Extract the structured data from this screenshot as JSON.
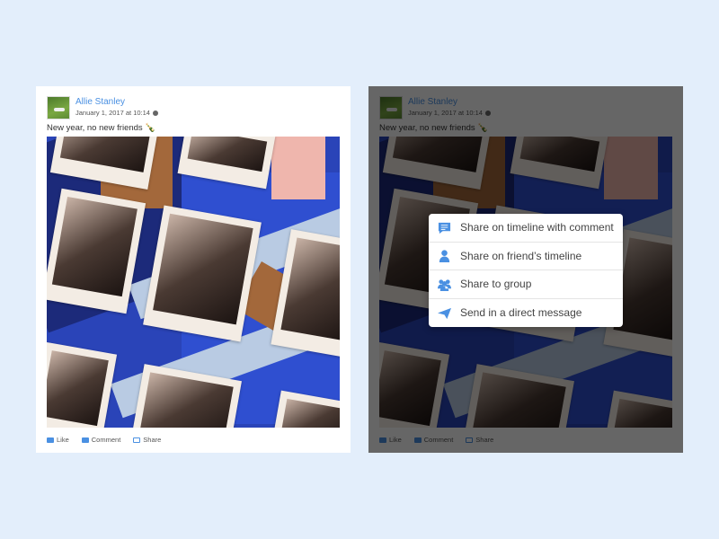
{
  "post": {
    "author": "Allie Stanley",
    "date": "January 1, 2017 at 10:14",
    "text": "New year, no new friends",
    "emoji": "🍾",
    "actions": {
      "like": "Like",
      "comment": "Comment",
      "share": "Share"
    }
  },
  "share_menu": {
    "items": [
      {
        "label": "Share on timeline with comment",
        "icon": "comment-icon"
      },
      {
        "label": "Share on friend’s timeline",
        "icon": "person-icon"
      },
      {
        "label": "Share to group",
        "icon": "group-icon"
      },
      {
        "label": "Send in a direct message",
        "icon": "paper-plane-icon"
      }
    ]
  },
  "colors": {
    "accent": "#4a90e2",
    "background": "#e3eefb"
  }
}
